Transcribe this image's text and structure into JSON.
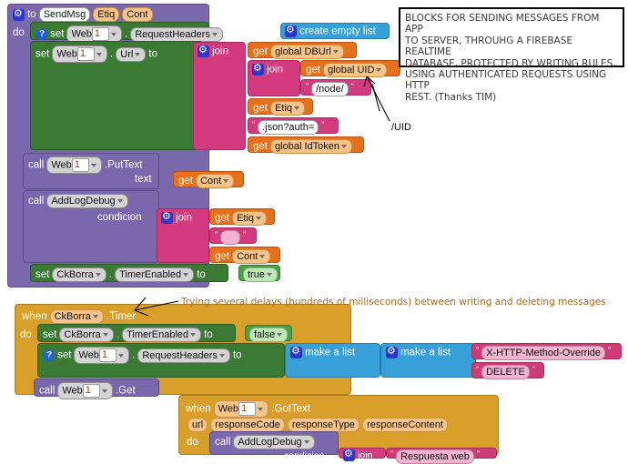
{
  "proc_sendmsg": {
    "keyword_to": "to",
    "name": "SendMsg",
    "params": [
      "Etiq",
      "Cont"
    ],
    "keyword_do": "do",
    "set1": {
      "kw_set": "set",
      "component": "Web",
      "index": "1",
      "dot": ".",
      "property": "RequestHeaders",
      "kw_to": "to",
      "value": "create empty list"
    },
    "set2": {
      "kw_set": "set",
      "component": "Web",
      "index": "1",
      "dot": ".",
      "property": "Url",
      "kw_to": "to"
    },
    "join_outer": "join",
    "join_inner": "join",
    "get_dburl": {
      "kw_get": "get",
      "name": "global DBUrl"
    },
    "get_uid": {
      "kw_get": "get",
      "name": "global UID"
    },
    "text_node": "/node/",
    "get_etiq": {
      "kw_get": "get",
      "name": "Etiq"
    },
    "text_jsonauth": ".json?auth=",
    "get_idtoken": {
      "kw_get": "get",
      "name": "global IdToken"
    },
    "call_puttext": {
      "kw_call": "call",
      "component": "Web",
      "index": "1",
      "method": ".PutText",
      "arg_label": "text"
    },
    "get_cont": {
      "kw_get": "get",
      "name": "Cont"
    },
    "call_addlogdebug": {
      "kw_call": "call",
      "name": "AddLogDebug",
      "arg_label": "condicion"
    },
    "join2": "join",
    "get_etiq2": {
      "kw_get": "get",
      "name": "Etiq"
    },
    "text_blank": "",
    "get_cont2": {
      "kw_get": "get",
      "name": "Cont"
    },
    "set_timer": {
      "kw_set": "set",
      "component": "CkBorra",
      "dot": ".",
      "property": "TimerEnabled",
      "kw_to": "to",
      "value": "true"
    }
  },
  "event_timer": {
    "kw_when": "when",
    "component": "CkBorra",
    "event": ".Timer",
    "kw_do": "do",
    "set_timer": {
      "kw_set": "set",
      "component": "CkBorra",
      "dot": ".",
      "property": "TimerEnabled",
      "kw_to": "to",
      "value": "false"
    },
    "set_headers": {
      "kw_set": "set",
      "component": "Web",
      "index": "1",
      "dot": ".",
      "property": "RequestHeaders",
      "kw_to": "to"
    },
    "make_list_outer": "make a list",
    "make_list_inner": "make a list",
    "text_header_key": "X-HTTP-Method-Override",
    "text_header_val": "DELETE",
    "call_get": {
      "kw_call": "call",
      "component": "Web",
      "index": "1",
      "method": ".Get"
    }
  },
  "event_gottext": {
    "kw_when": "when",
    "component": "Web",
    "index": "1",
    "event": ".GotText",
    "params": [
      "url",
      "responseCode",
      "responseType",
      "responseContent"
    ],
    "kw_do": "do",
    "call_addlogdebug": {
      "kw_call": "call",
      "name": "AddLogDebug",
      "arg_label": "condicion"
    },
    "join": "join",
    "text_respuesta": "Respuesta web"
  },
  "comment": {
    "lines": [
      "BLOCKS FOR SENDING MESSAGES FROM APP",
      "TO SERVER, THROUHG A FIREBASE REALTIME",
      "DATABASE,  PROTECTED BY WRITING RULES,",
      "USING AUTHENTICATED REQUESTS USING HTTP",
      "REST.  (Thanks TIM)"
    ]
  },
  "annotations": {
    "uid": "/UID",
    "delays": "Trying several delays (hundreds of milliseconds) between writing and deleting messages"
  },
  "colors": {
    "control": "#7a68ad",
    "setter": "#3a7a33",
    "text": "#d43b7e",
    "variable": "#e8701a",
    "list": "#38a0d8",
    "event": "#d9a029",
    "logic": "#4e9e45",
    "note": "#b06a16"
  }
}
